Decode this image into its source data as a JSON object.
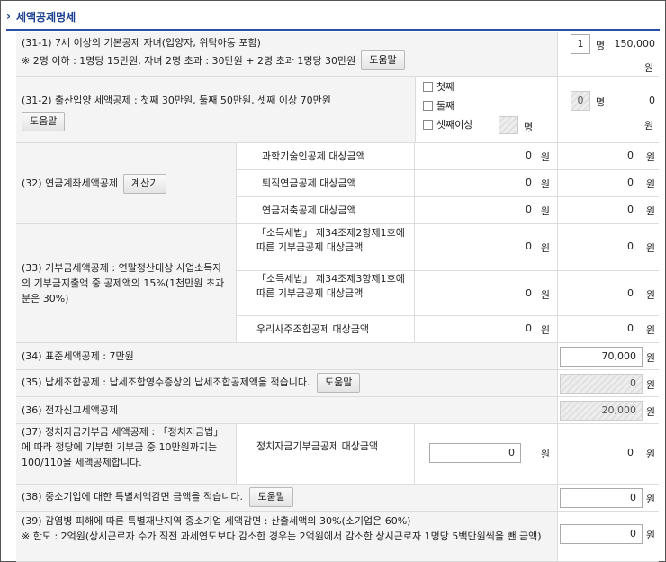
{
  "section": {
    "title": "세액공제명세"
  },
  "units": {
    "won": "원",
    "people": "명"
  },
  "help_label": "도움말",
  "calc_label": "계산기",
  "r31_1": {
    "label_line1": "(31-1) 7세 이상의 기본공제 자녀(입양자, 위탁아동 포함)",
    "label_line2": "※ 2명 이하 : 1명당 15만원, 자녀 2명 초과 : 30만원 + 2명 초과 1명당 30만원",
    "count": "1",
    "amount": "150,000"
  },
  "r31_2": {
    "label": "(31-2) 출산입양 세액공제 : 첫째 30만원, 둘째 50만원, 셋째 이상 70만원",
    "options": [
      "첫째",
      "둘째",
      "셋째이상"
    ],
    "count": "0",
    "amount": "0"
  },
  "r32": {
    "label": "(32) 연금계좌세액공제",
    "items": [
      {
        "label": "과학기술인공제 대상금액",
        "base": "0",
        "credit": "0"
      },
      {
        "label": "퇴직연금공제 대상금액",
        "base": "0",
        "credit": "0"
      },
      {
        "label": "연금저축공제 대상금액",
        "base": "0",
        "credit": "0"
      }
    ]
  },
  "r33": {
    "label": "(33) 기부금세액공제 : 연말정산대상 사업소득자의 기부금지출액 중 공제액의 15%(1천만원 초과분은 30%)",
    "items": [
      {
        "label": "「소득세법」 제34조제2항제1호에 따른 기부금공제 대상금액",
        "base": "0",
        "credit": "0"
      },
      {
        "label": "「소득세법」 제34조제3항제1호에 따른 기부금공제 대상금액",
        "base": "0",
        "credit": "0"
      },
      {
        "label": "우리사주조합공제 대상금액",
        "base": "0",
        "credit": "0"
      }
    ]
  },
  "r34": {
    "label": "(34) 표준세액공제 : 7만원",
    "amount": "70,000"
  },
  "r35": {
    "label": "(35) 납세조합공제 : 납세조합영수증상의 납세조합공제액을 적습니다.",
    "amount": "0"
  },
  "r36": {
    "label": "(36) 전자신고세액공제",
    "amount": "20,000"
  },
  "r37": {
    "label": "(37) 정치자금기부금 세액공제 : 「정치자금법」에 따라 정당에 기부한 기부금 중 10만원까지는 100/110을 세액공제합니다.",
    "sub_label": "정치자금기부금공제 대상금액",
    "base": "0",
    "amount": "0"
  },
  "r38": {
    "label": "(38) 중소기업에 대한 특별세액감면 금액을 적습니다.",
    "amount": "0"
  },
  "r39": {
    "label_line1": "(39) 감염병 피해에 따른 특별재난지역 중소기업 세액감면 : 산출세액의 30%(소기업은 60%)",
    "label_line2": "※ 한도 : 2억원(상시근로자 수가 직전 과세연도보다 감소한 경우는 2억원에서 감소한 상시근로자 1명당 5백만원씩을 뺀 금액)",
    "amount": "0"
  }
}
